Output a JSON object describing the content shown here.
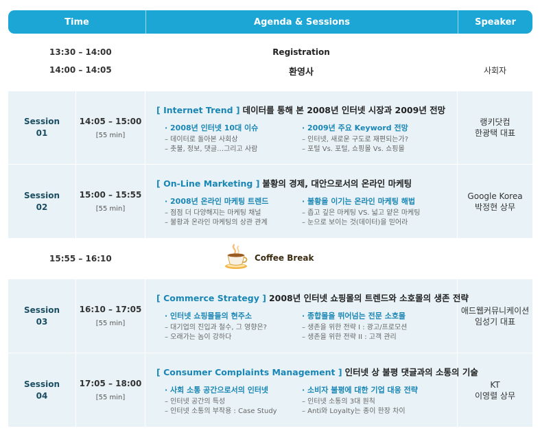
{
  "header": {
    "time": "Time",
    "agenda": "Agenda & Sessions",
    "speaker": "Speaker"
  },
  "intro": [
    {
      "time": "13:30 – 14:00",
      "agenda": "Registration",
      "speaker": ""
    },
    {
      "time": "14:00 – 14:05",
      "agenda": "환영사",
      "speaker": "사회자"
    }
  ],
  "sessions": [
    {
      "label": "Session",
      "num": "01",
      "time": "14:05 – 15:00",
      "duration": "[55 min]",
      "tag": "[ Internet Trend ]",
      "title": "데이터를 통해 본 2008년 인터넷 시장과 2009년 전망",
      "left_head": "· 2008년 인터넷 10대 이슈",
      "left_items": [
        "– 데이터로 돌아본 사회상",
        "– 촛불, 정보, 댓글…그리고 사람"
      ],
      "right_head": "· 2009년 주요 Keyword 전망",
      "right_items": [
        "– 인터넷, 새로운 구도로 재편되는가?",
        "– 포털 Vs. 포털, 쇼핑몰 Vs. 쇼핑몰"
      ],
      "speaker1": "랭키닷컴",
      "speaker2": "한광택 대표"
    },
    {
      "label": "Session",
      "num": "02",
      "time": "15:00 – 15:55",
      "duration": "[55 min]",
      "tag": "[ On-Line Marketing ]",
      "title": "불황의 경제, 대안으로서의 온라인 마케팅",
      "left_head": "· 2008년 온라인 마케팅 트렌드",
      "left_items": [
        "– 점점 더 다양해지는 마케팅 채널",
        "– 불황과 온라인 마케팅의 상관 관계"
      ],
      "right_head": "· 불황을 이기는 온라인 마케팅 해법",
      "right_items": [
        "– 좁고 깊은 마케팅 VS. 넓고 얕은 마케팅",
        "– 눈으로 보이는 것(데이터)을 믿어라"
      ],
      "speaker1": "Google Korea",
      "speaker2": "박정현 상무"
    },
    {
      "label": "Session",
      "num": "03",
      "time": "16:10 – 17:05",
      "duration": "[55 min]",
      "tag": "[ Commerce Strategy ]",
      "title": "2008년 인터넷 쇼핑몰의 트렌드와 소호몰의 생존 전략",
      "left_head": "· 인터넷 쇼핑몰들의 현주소",
      "left_items": [
        "– 대기업의 진입과 철수, 그 영향은?",
        "– 오래가는 놈이 강하다"
      ],
      "right_head": "· 종합몰을 뛰어넘는 전문 소호몰",
      "right_items": [
        "– 생존을 위한 전략 I : 광고/프로모션",
        "– 생존을 위한 전략 II : 고객 관리"
      ],
      "speaker1": "애드웹커뮤니케이션",
      "speaker2": "임성기 대표"
    },
    {
      "label": "Session",
      "num": "04",
      "time": "17:05 – 18:00",
      "duration": "[55 min]",
      "tag": "[ Consumer Complaints Management ]",
      "title": "인터넷 상 불평 댓글과의 소통의 기술",
      "left_head": "· 사회 소통 공간으로서의 인터넷",
      "left_items": [
        "– 인터넷 공간의 특성",
        "– 인터넷 소통의 부작용 : Case Study"
      ],
      "right_head": "· 소비자 불평에 대한 기업 대응 전략",
      "right_items": [
        "– 인터넷 소통의 3대 원칙",
        "– Anti와 Loyalty는 종이 한장 차이"
      ],
      "speaker1": "KT",
      "speaker2": "이영렬 상무"
    }
  ],
  "coffee": {
    "time": "15:55 – 16:10",
    "label": "Coffee Break",
    "icon": "coffee-cup-icon"
  },
  "colors": {
    "header": "#1ba6d6",
    "session_bg": "#e9f3f7",
    "accent": "#1a86b5",
    "session_label": "#1b4d63"
  }
}
